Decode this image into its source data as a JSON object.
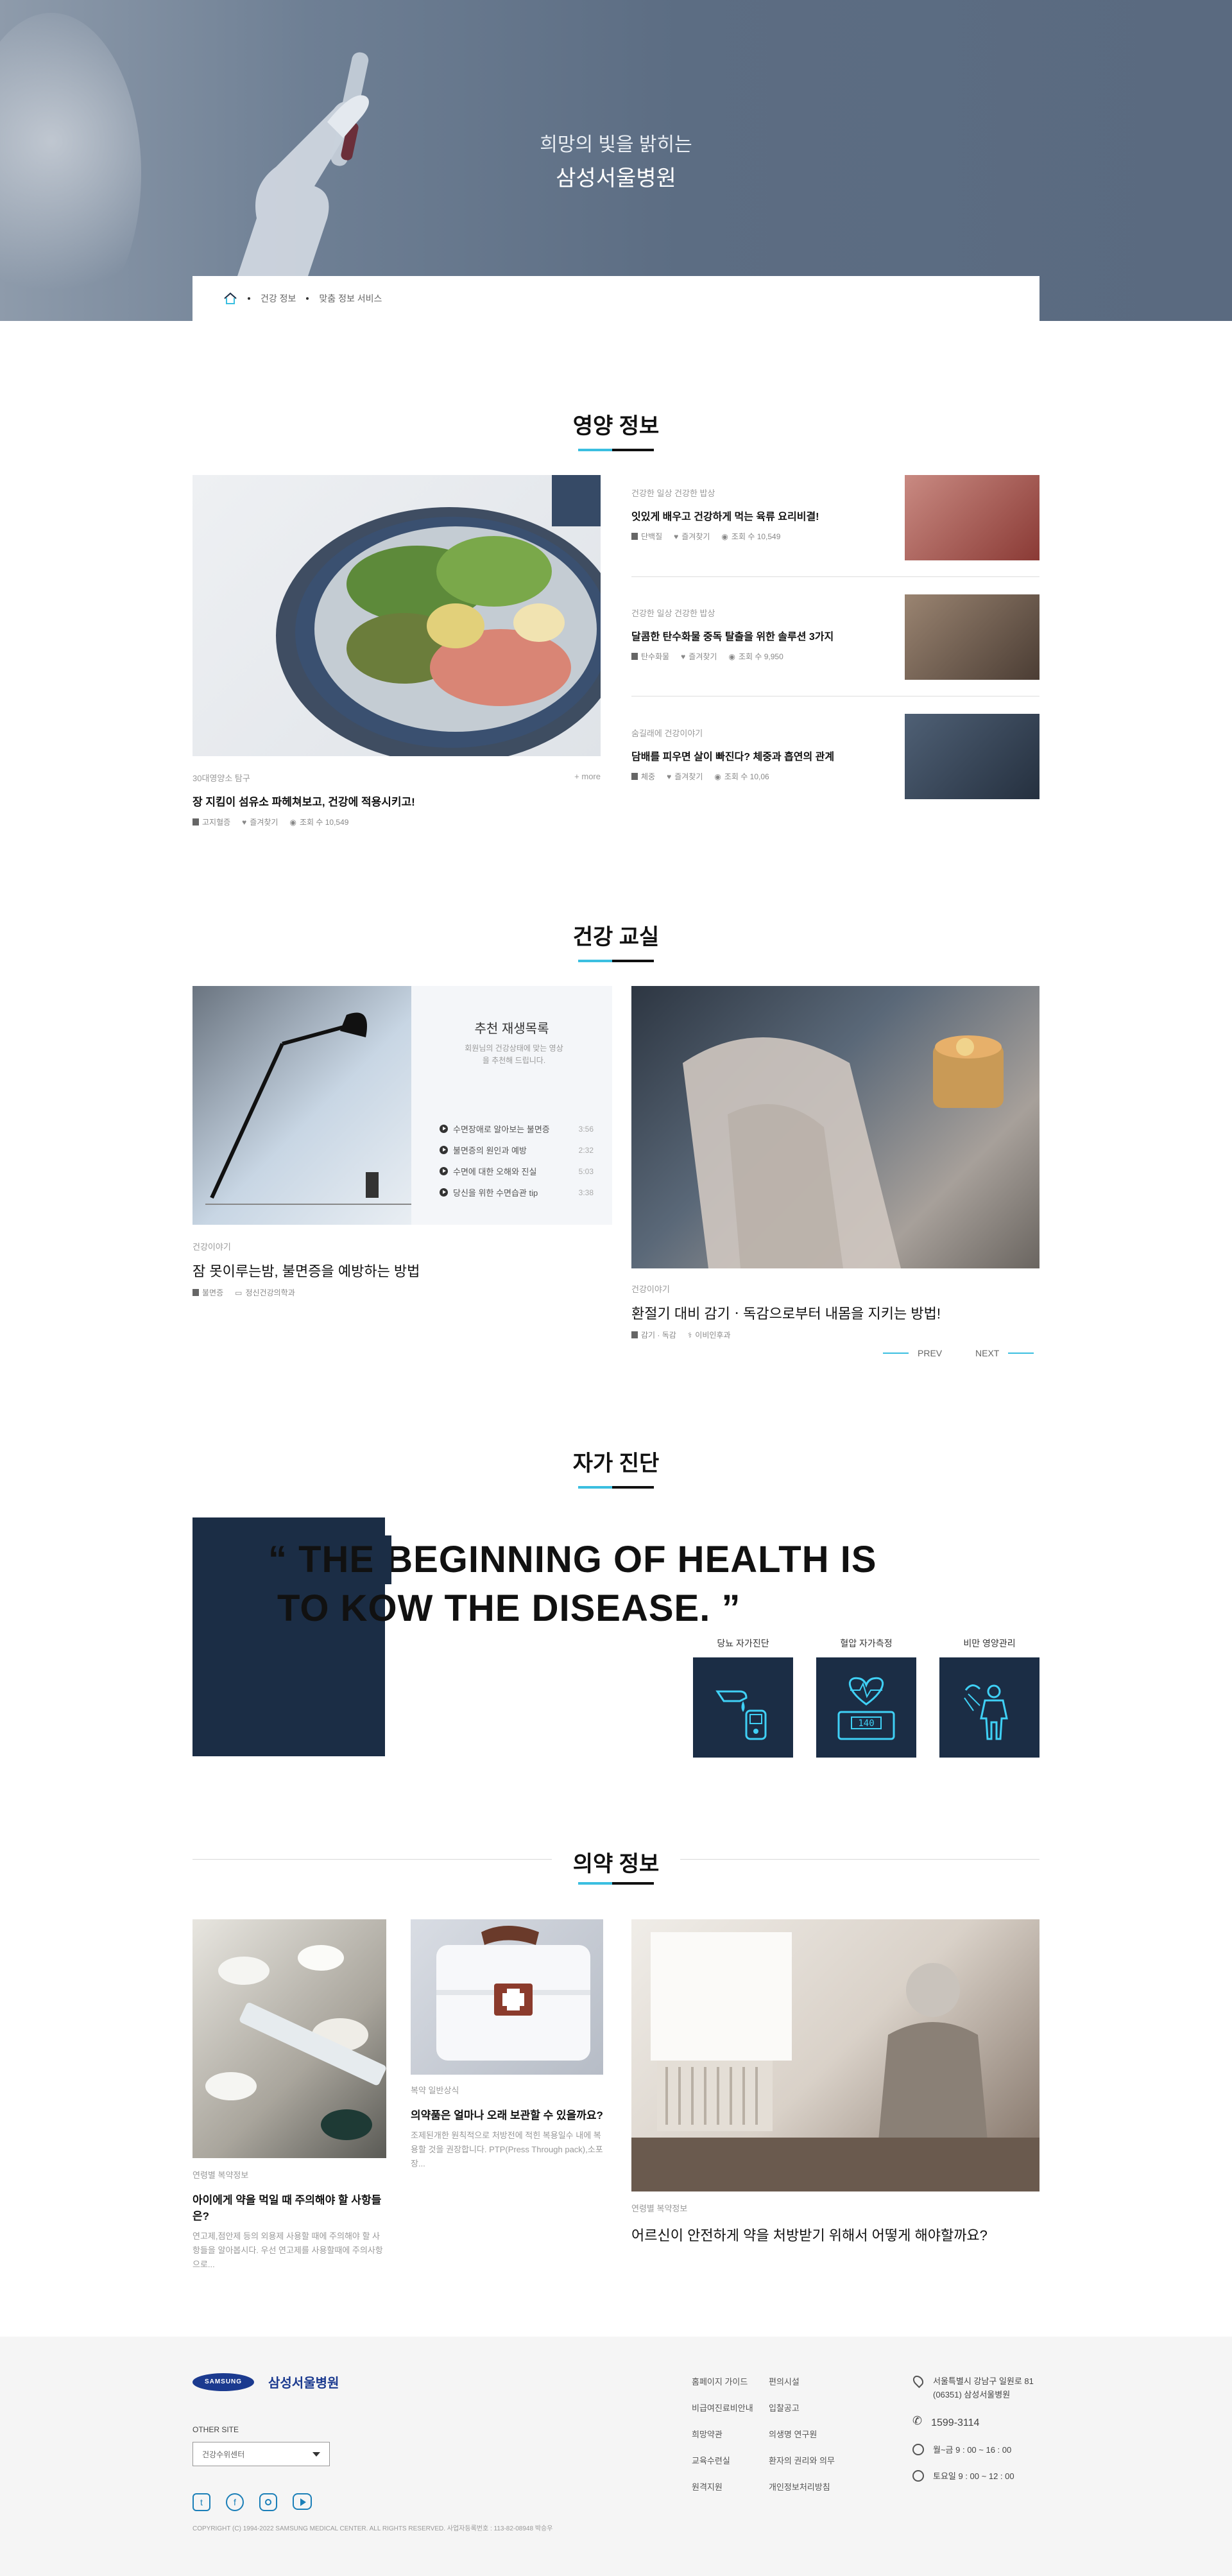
{
  "hero": {
    "subtitle": "희망의 빛을 밝히는",
    "title": "삼성서울병원"
  },
  "breadcrumb": {
    "items": [
      "건강 정보",
      "맞춤 정보 서비스"
    ]
  },
  "nutrition": {
    "title": "영양 정보",
    "featured": {
      "category": "30대영양소 탐구",
      "title": "장 지킴이 섬유소 파헤쳐보고, 건강에 적용시키고!",
      "tag": "고지혈증",
      "fav": "즐겨찾기",
      "views": "조회 수 10,549",
      "more": "+ more"
    },
    "items": [
      {
        "category": "건강한 일상 건강한 밥상",
        "title": "잇있게 배우고 건강하게 먹는 육류 요리비결!",
        "tag": "단백질",
        "fav": "즐겨찾기",
        "views": "조회 수 10,549"
      },
      {
        "category": "건강한 일상 건강한 밥상",
        "title": "달콤한 탄수화물 중독 탈출을 위한 솔루션 3가지",
        "tag": "탄수화물",
        "fav": "즐겨찾기",
        "views": "조회 수 9,950"
      },
      {
        "category": "숨길래에 건강이야기",
        "title": "담배를 피우면 살이 빠진다? 체중과 흡연의 관계",
        "tag": "체중",
        "fav": "즐겨찾기",
        "views": "조회 수 10,06"
      }
    ]
  },
  "class": {
    "title": "건강 교실",
    "playlist": {
      "title": "추천 재생목록",
      "desc": "회원님의 건강상태에 맞는 영상을 추천해 드립니다.",
      "items": [
        {
          "label": "수면장애로 알아보는 불면증",
          "time": "3:56"
        },
        {
          "label": "불면증의 원인과 예방",
          "time": "2:32"
        },
        {
          "label": "수면에 대한 오해와 진실",
          "time": "5:03"
        },
        {
          "label": "당신을 위한 수면습관 tip",
          "time": "3:38"
        }
      ]
    },
    "left": {
      "category": "건강이야기",
      "title": "잠 못이루는밤, 불면증을 예방하는 방법",
      "tag": "불면증",
      "author": "정신건강의학과"
    },
    "right": {
      "category": "건강이야기",
      "title": "환절기 대비 감기ㆍ독감으로부터 내몸을 지키는 방법!",
      "tag": "감기 · 독감",
      "author": "이비인후과"
    },
    "prev": "PREV",
    "next": "NEXT"
  },
  "self": {
    "title": "자가 진단",
    "quote_line1": "“ THE BEGINNING OF HEALTH IS",
    "quote_line2": "TO KOW THE DISEASE. ”",
    "items": [
      {
        "label": "당뇨 자가진단",
        "icon": "diabetes-icon"
      },
      {
        "label": "혈압 자가측정",
        "icon": "blood-pressure-icon",
        "value": "140"
      },
      {
        "label": "비만 영양관리",
        "icon": "obesity-icon"
      }
    ]
  },
  "medicine": {
    "title": "의약 정보",
    "items": [
      {
        "category": "연령별 복약정보",
        "title": "아이에게 약을 먹일 때 주의해야 할 사항들은?",
        "desc": "연고제,점안제 등의 외용제 사용할 때에 주의해야 할 사항들을 알아봅시다. 우선 연고제를 사용할때에 주의사항으로..."
      },
      {
        "category": "복약 일반상식",
        "title": "의약품은 얼마나 오래 보관할 수 있을까요?",
        "desc": "조제된개한 원칙적으로 처방전에 적힌 복용일수 내에 복용할 것을 권장합니다. PTP(Press Through pack),소포장..."
      },
      {
        "category": "연령별 복약정보",
        "title": "어르신이 안전하게 약을 처방받기 위해서 어떻게 해야할까요?"
      }
    ]
  },
  "footer": {
    "logo": "SAMSUNG",
    "hospital": "삼성서울병원",
    "other_site_label": "OTHER SITE",
    "other_site_value": "건강수위센터",
    "links": [
      "홈페이지 가이드",
      "편의시설",
      "비급여진료비안내",
      "입찰공고",
      "희망약관",
      "의생명 연구원",
      "교육수련실",
      "환자의 권리와 의무",
      "원격지원",
      "개인정보처리방침"
    ],
    "address": "서울특별시 강남구 일원로 81 (06351) 삼성서울병원",
    "phone": "1599-3114",
    "weekday": "월~금  9 : 00 ~ 16 : 00",
    "saturday": "토요일  9 : 00 ~ 12 : 00",
    "copyright": "COPYRIGHT (C) 1994-2022 SAMSUNG MEDICAL CENTER. ALL RIGHTS RESERVED. 사업자등록번호 : 113-82-08948 박승우"
  },
  "colors": {
    "navy": "#1b2d45",
    "accent": "#3bbfe0",
    "hero": "#5c6d83"
  }
}
